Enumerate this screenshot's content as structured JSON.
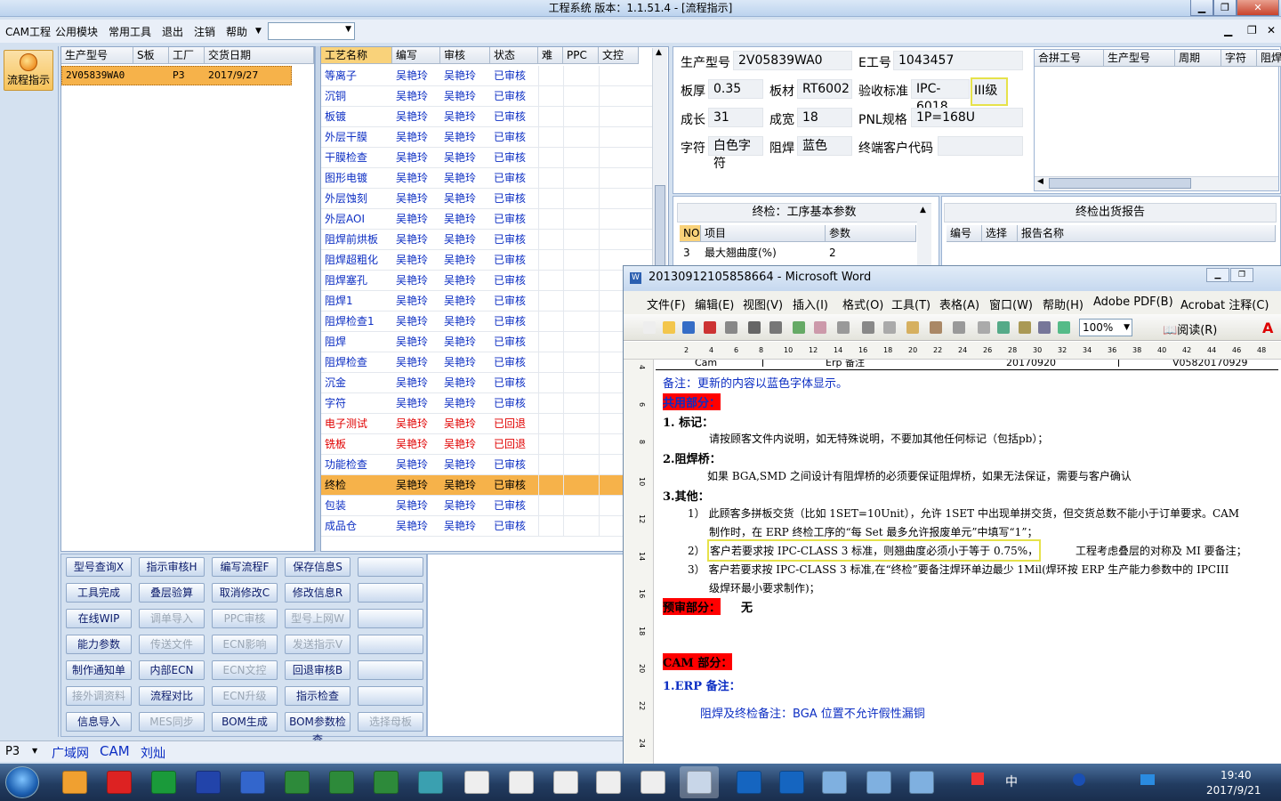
{
  "app": {
    "title": "工程系统   版本：1.1.51.4 - [流程指示]",
    "menu": [
      "CAM工程",
      "公用模块",
      "常用工具",
      "退出",
      "注销",
      "帮助"
    ],
    "left_button": "流程指示"
  },
  "orders": {
    "headers": [
      "生产型号",
      "S板",
      "工厂",
      "交货日期"
    ],
    "rows": [
      [
        "2V05839WA0",
        "",
        "P3",
        "2017/9/27"
      ]
    ]
  },
  "process": {
    "headers": [
      "工艺名称",
      "编写",
      "审核",
      "状态",
      "难",
      "PPC",
      "文控"
    ],
    "rows": [
      {
        "name": "等离子",
        "writer": "吴艳玲",
        "reviewer": "吴艳玲",
        "status": "已审核",
        "color": "blue"
      },
      {
        "name": "沉铜",
        "writer": "吴艳玲",
        "reviewer": "吴艳玲",
        "status": "已审核",
        "color": "blue"
      },
      {
        "name": "板镀",
        "writer": "吴艳玲",
        "reviewer": "吴艳玲",
        "status": "已审核",
        "color": "blue"
      },
      {
        "name": "外层干膜",
        "writer": "吴艳玲",
        "reviewer": "吴艳玲",
        "status": "已审核",
        "color": "blue"
      },
      {
        "name": "干膜检查",
        "writer": "吴艳玲",
        "reviewer": "吴艳玲",
        "status": "已审核",
        "color": "blue"
      },
      {
        "name": "图形电镀",
        "writer": "吴艳玲",
        "reviewer": "吴艳玲",
        "status": "已审核",
        "color": "blue"
      },
      {
        "name": "外层蚀刻",
        "writer": "吴艳玲",
        "reviewer": "吴艳玲",
        "status": "已审核",
        "color": "blue"
      },
      {
        "name": "外层AOI",
        "writer": "吴艳玲",
        "reviewer": "吴艳玲",
        "status": "已审核",
        "color": "blue"
      },
      {
        "name": "阻焊前烘板",
        "writer": "吴艳玲",
        "reviewer": "吴艳玲",
        "status": "已审核",
        "color": "blue"
      },
      {
        "name": "阻焊超粗化",
        "writer": "吴艳玲",
        "reviewer": "吴艳玲",
        "status": "已审核",
        "color": "blue"
      },
      {
        "name": "阻焊塞孔",
        "writer": "吴艳玲",
        "reviewer": "吴艳玲",
        "status": "已审核",
        "color": "blue"
      },
      {
        "name": "阻焊1",
        "writer": "吴艳玲",
        "reviewer": "吴艳玲",
        "status": "已审核",
        "color": "blue"
      },
      {
        "name": "阻焊检查1",
        "writer": "吴艳玲",
        "reviewer": "吴艳玲",
        "status": "已审核",
        "color": "blue"
      },
      {
        "name": "阻焊",
        "writer": "吴艳玲",
        "reviewer": "吴艳玲",
        "status": "已审核",
        "color": "blue"
      },
      {
        "name": "阻焊检查",
        "writer": "吴艳玲",
        "reviewer": "吴艳玲",
        "status": "已审核",
        "color": "blue"
      },
      {
        "name": "沉金",
        "writer": "吴艳玲",
        "reviewer": "吴艳玲",
        "status": "已审核",
        "color": "blue"
      },
      {
        "name": "字符",
        "writer": "吴艳玲",
        "reviewer": "吴艳玲",
        "status": "已审核",
        "color": "blue"
      },
      {
        "name": "电子测试",
        "writer": "吴艳玲",
        "reviewer": "吴艳玲",
        "status": "已回退",
        "color": "red"
      },
      {
        "name": "铣板",
        "writer": "吴艳玲",
        "reviewer": "吴艳玲",
        "status": "已回退",
        "color": "red"
      },
      {
        "name": "功能检查",
        "writer": "吴艳玲",
        "reviewer": "吴艳玲",
        "status": "已审核",
        "color": "blue"
      },
      {
        "name": "终检",
        "writer": "吴艳玲",
        "reviewer": "吴艳玲",
        "status": "已审核",
        "color": "blue",
        "selected": true
      },
      {
        "name": "包装",
        "writer": "吴艳玲",
        "reviewer": "吴艳玲",
        "status": "已审核",
        "color": "blue"
      },
      {
        "name": "成品仓",
        "writer": "吴艳玲",
        "reviewer": "吴艳玲",
        "status": "已审核",
        "color": "blue"
      }
    ]
  },
  "buttons": [
    [
      "型号查询X",
      "指示审核H",
      "编写流程F",
      "保存信息S",
      ""
    ],
    [
      "工具完成",
      "叠层验算",
      "取消修改C",
      "修改信息R",
      ""
    ],
    [
      "在线WIP",
      "调单导入",
      "PPC审核",
      "型号上网W",
      ""
    ],
    [
      "能力参数",
      "传送文件",
      "ECN影响",
      "发送指示V",
      ""
    ],
    [
      "制作通知单",
      "内部ECN",
      "ECN文控",
      "回退审核B",
      ""
    ],
    [
      "接外调资料",
      "流程对比",
      "ECN升级",
      "指示检查",
      ""
    ],
    [
      "信息导入",
      "MES同步",
      "BOM生成",
      "BOM参数检查",
      "选择母板"
    ]
  ],
  "buttons_disabled": [
    "调单导入",
    "PPC审核",
    "型号上网W",
    "传送文件",
    "ECN影响",
    "发送指示V",
    "ECN文控",
    "接外调资料",
    "ECN升级",
    "MES同步",
    "选择母板"
  ],
  "info": {
    "model_label": "生产型号",
    "model": "2V05839WA0",
    "e_label": "E工号",
    "e_value": "1043457",
    "thick_label": "板厚",
    "thick": "0.35",
    "material_label": "板材",
    "material": "RT6002",
    "std_label": "验收标准",
    "std": "IPC-6018",
    "grade": "III级",
    "grow_label": "成长",
    "grow": "31",
    "finish_label": "成宽",
    "finish": "18",
    "pnl_label": "PNL规格",
    "pnl": "1P=168U",
    "char_label": "字符",
    "char": "白色字符",
    "mask_label": "阻焊",
    "mask": "蓝色",
    "cust_label": "终端客户代码",
    "cust": ""
  },
  "merge": {
    "headers": [
      "合拼工号",
      "生产型号",
      "周期",
      "字符",
      "阻焊"
    ]
  },
  "final_params": {
    "title": "终检：工序基本参数",
    "headers": [
      "NO",
      "项目",
      "参数"
    ],
    "rows": [
      [
        "3",
        "最大翘曲度(%)",
        "2"
      ]
    ]
  },
  "final_report": {
    "title": "终检出货报告",
    "headers": [
      "编号",
      "选择",
      "报告名称"
    ]
  },
  "statusbar": {
    "combo": "P3",
    "items": [
      "广域网",
      "CAM",
      "刘灿"
    ]
  },
  "word": {
    "title": "20130912105858664 - Microsoft Word",
    "menu": [
      "文件(F)",
      "编辑(E)",
      "视图(V)",
      "插入(I)",
      "格式(O)",
      "工具(T)",
      "表格(A)",
      "窗口(W)",
      "帮助(H)",
      "Adobe PDF(B)",
      "Acrobat 注释(C)"
    ],
    "zoom": "100%",
    "read": "阅读(R)",
    "ruler_numbers": [
      "2",
      "4",
      "6",
      "8",
      "10",
      "12",
      "14",
      "16",
      "18",
      "20",
      "22",
      "24",
      "26",
      "28",
      "30",
      "32",
      "34",
      "36",
      "38",
      "40",
      "42",
      "44",
      "46",
      "48"
    ],
    "vruler_numbers": [
      "4",
      "6",
      "8",
      "10",
      "12",
      "14",
      "16",
      "18",
      "20",
      "22",
      "24"
    ],
    "top_row": [
      "Cam",
      "Erp 备注",
      "20170920",
      "V05820170929"
    ],
    "note": "备注：更新的内容以蓝色字体显示。",
    "common": "共用部分：",
    "s1_title": "1.  标记：",
    "s1_text": "请按顾客文件内说明，如无特殊说明，不要加其他任何标记（包括pb）；",
    "s2_title": "2.阻焊桥：",
    "s2_text": "如果 BGA,SMD 之间设计有阻焊桥的必须要保证阻焊桥，如果无法保证，需要与客户确认",
    "s3_title": "3.其他：",
    "s3_1a": "1） 此顾客多拼板交货（比如 1SET=10Unit），允许 1SET 中出现单拼交货，但交货总数不能小于订单要求。CAM",
    "s3_1b": "制作时，在 ERP 终检工序的“每 Set 最多允许报废单元”中填写“1”；",
    "s3_2a": "2） ",
    "s3_2b": "客户若要求按 IPC-CLASS 3 标准，则翘曲度必须小于等于 0.75%，",
    "s3_2c": "工程考虑叠层的对称及 MI 要备注；",
    "s3_3a": "3） 客户若要求按 IPC-CLASS 3 标准,在“终检”要备注焊环单边最少 1Mil(焊环按 ERP 生产能力参数中的 IPCIII",
    "s3_3b": "级焊环最小要求制作)；",
    "pre": "预审部分：",
    "pre_val": "无",
    "cam": "CAM 部分：",
    "erp": "1.ERP 备注：",
    "erp_text": "阻焊及终检备注：BGA 位置不允许假性漏铜"
  },
  "clock": {
    "time": "19:40",
    "date": "2017/9/21",
    "ime": "中"
  }
}
